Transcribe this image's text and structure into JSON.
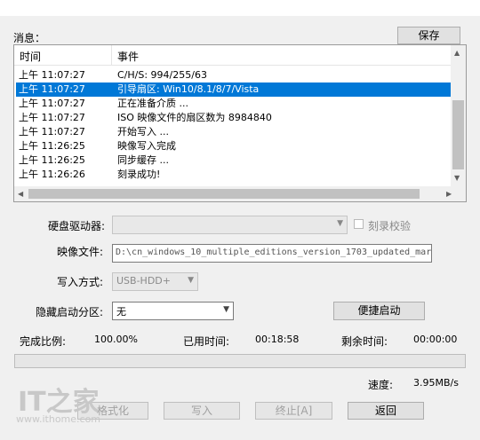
{
  "toolbar": {
    "save_label": "保存"
  },
  "messages": {
    "label": "消息：",
    "columns": {
      "time": "时间",
      "event": "事件"
    },
    "rows": [
      {
        "time": "上午 11:07:27",
        "event": "C/H/S: 994/255/63"
      },
      {
        "time": "上午 11:07:27",
        "event": "引导扇区: Win10/8.1/8/7/Vista",
        "selected": true
      },
      {
        "time": "上午 11:07:27",
        "event": "正在准备介质 ..."
      },
      {
        "time": "上午 11:07:27",
        "event": "ISO 映像文件的扇区数为 8984840"
      },
      {
        "time": "上午 11:07:27",
        "event": "开始写入 ..."
      },
      {
        "time": "上午 11:26:25",
        "event": "映像写入完成"
      },
      {
        "time": "上午 11:26:25",
        "event": "同步缓存 ..."
      },
      {
        "time": "上午 11:26:26",
        "event": "刻录成功!"
      }
    ]
  },
  "form": {
    "disk_label": "硬盘驱动器:",
    "disk_value": "",
    "verify_label": "刻录校验",
    "image_label": "映像文件:",
    "image_value": "D:\\cn_windows_10_multiple_editions_version_1703_updated_mar",
    "write_mode_label": "写入方式:",
    "write_mode_value": "USB-HDD+",
    "hidden_partition_label": "隐藏启动分区:",
    "hidden_partition_value": "无",
    "quick_boot_label": "便捷启动"
  },
  "status": {
    "complete_label": "完成比例:",
    "complete_value": "100.00%",
    "elapsed_label": "已用时间:",
    "elapsed_value": "00:18:58",
    "remaining_label": "剩余时间:",
    "remaining_value": "00:00:00",
    "progress": 0,
    "speed_label": "速度:",
    "speed_value": "3.95MB/s"
  },
  "actions": {
    "format": "格式化",
    "write": "写入",
    "abort": "终止[A]",
    "back": "返回"
  },
  "watermark": {
    "logo": "IT之家",
    "url": "www.ithome.com"
  }
}
